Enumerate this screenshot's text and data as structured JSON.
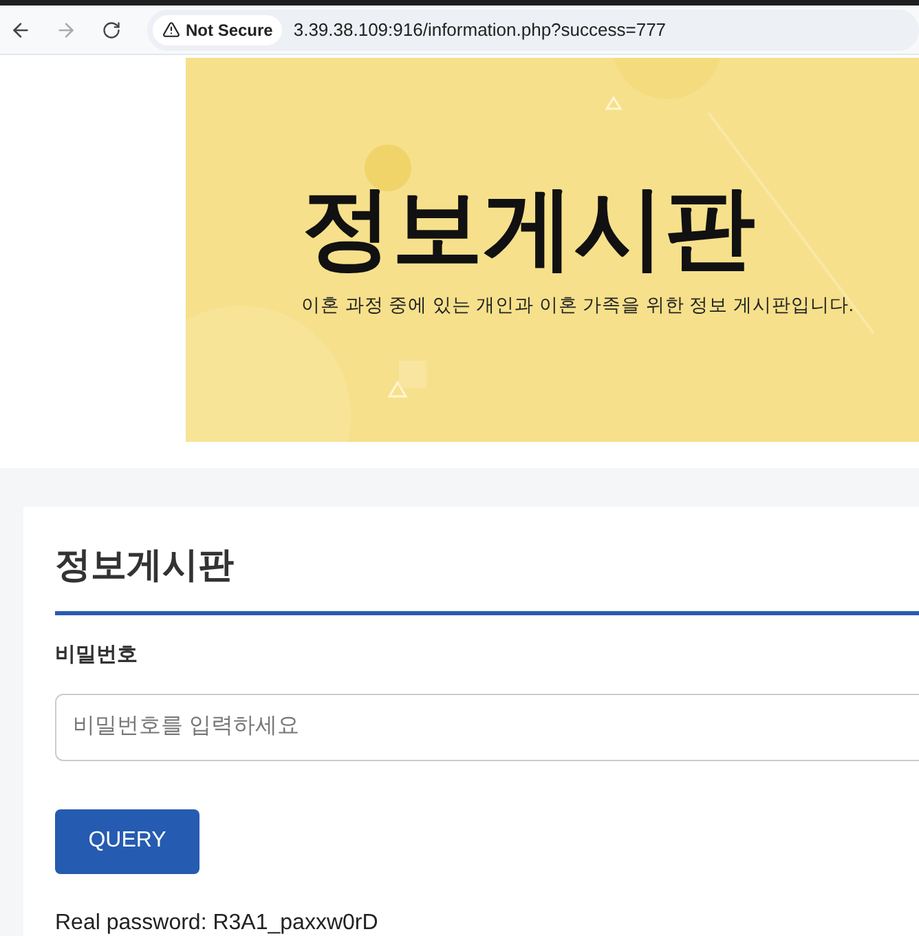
{
  "browser": {
    "security": "Not Secure",
    "url": "3.39.38.109:916/information.php?success=777"
  },
  "banner": {
    "title": "정보게시판",
    "subtitle": "이혼 과정 중에 있는 개인과 이혼 가족을 위한 정보 게시판입니다."
  },
  "card": {
    "title": "정보게시판",
    "label": "비밀번호",
    "password_field": {
      "placeholder": "비밀번호를 입력하세요"
    },
    "button": "QUERY",
    "result": "Real password: R3A1_paxxw0rD"
  }
}
